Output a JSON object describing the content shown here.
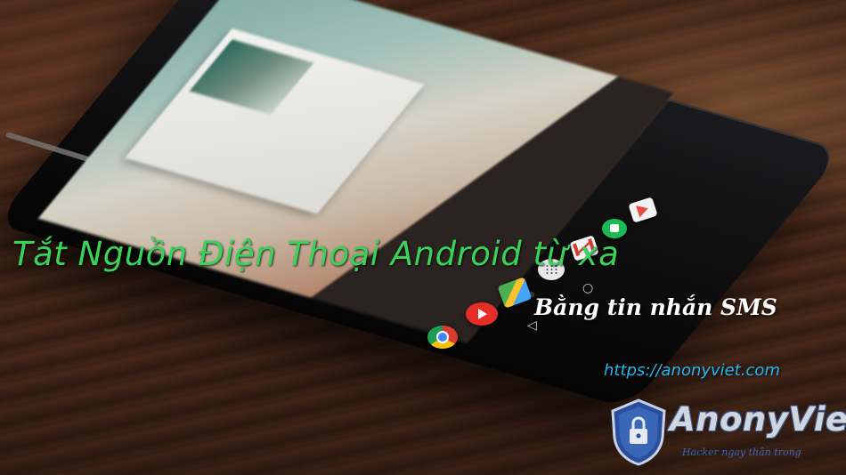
{
  "overlay": {
    "title": "Tắt Nguồn Điện Thoại Android từ xa",
    "subtitle": "Bằng tin nhắn SMS",
    "url": "https://anonyviet.com"
  },
  "logo": {
    "wordmark": "AnonyViet",
    "tagline": "Hacker ngay thân trong"
  },
  "colors": {
    "title": "#3bd25a",
    "subtitle": "#ffffff",
    "url": "#26b6ee",
    "logo_blue": "#3a66b8"
  },
  "dock_icons": [
    "chrome-icon",
    "youtube-icon",
    "maps-icon",
    "app-drawer-icon",
    "gmail-icon",
    "hangouts-icon",
    "play-store-icon"
  ],
  "nav_icons": [
    "back-icon",
    "home-icon"
  ]
}
